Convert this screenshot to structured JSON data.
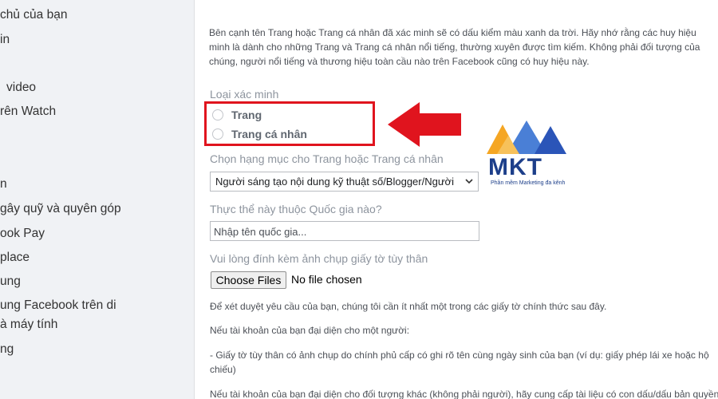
{
  "sidebar": {
    "items": [
      {
        "label": "chủ của bạn"
      },
      {
        "label": "in"
      },
      {
        "label": "video"
      },
      {
        "label": "rên Watch"
      },
      {
        "label": "n"
      },
      {
        "label": "gây quỹ và quyên góp"
      },
      {
        "label": "ook Pay"
      },
      {
        "label": "place"
      },
      {
        "label": "ung"
      },
      {
        "label": "ung Facebook trên di"
      },
      {
        "label": "à máy tính"
      },
      {
        "label": "ng"
      }
    ]
  },
  "main": {
    "intro_prefix": "Bên cạnh tên ",
    "intro_highlight": "Trang",
    "intro_rest": " hoặc Trang cá nhân đã xác minh sẽ có dấu kiểm màu xanh da trời. Hãy nhớ rằng các huy hiệu minh là dành cho những Trang và Trang cá nhân nổi tiếng, thường xuyên được tìm kiếm. Không phải đối tượng của chúng, người nổi tiếng và thương hiệu toàn cầu nào trên Facebook cũng có huy hiệu này.",
    "verification_type_label": "Loại xác minh",
    "options": [
      {
        "label": "Trang"
      },
      {
        "label": "Trang cá nhân"
      }
    ],
    "category_label": "Chọn hạng mục cho Trang hoặc Trang cá nhân",
    "category_value": "Người sáng tạo nội dung kỹ thuật số/Blogger/Người",
    "country_label": "Thực thể này thuộc Quốc gia nào?",
    "country_placeholder": "Nhập tên quốc gia...",
    "attach_label": "Vui lòng đính kèm ảnh chụp giấy tờ tùy thân",
    "choose_files_label": "Choose Files",
    "file_status": "No file chosen",
    "para1": "Để xét duyệt yêu cầu của bạn, chúng tôi cần ít nhất một trong các giấy tờ chính thức sau đây.",
    "para2": "Nếu tài khoản của bạn đại diện cho một người:",
    "para3": "- Giấy tờ tùy thân có ảnh chụp do chính phủ cấp có ghi rõ tên cùng ngày sinh của bạn (ví dụ: giấy phép lái xe hoặc hộ chiếu)",
    "para4": "Nếu tài khoản của bạn đại diện cho đối tượng khác (không phải người), hãy cung cấp tài liệu có con dấu/dấu bản quyền"
  },
  "overlay": {
    "highlight_color": "#e0141e",
    "arrow_icon": "left-arrow-icon",
    "logo_text": "MKT",
    "logo_tagline": "Phần mềm Marketing đa kênh"
  }
}
